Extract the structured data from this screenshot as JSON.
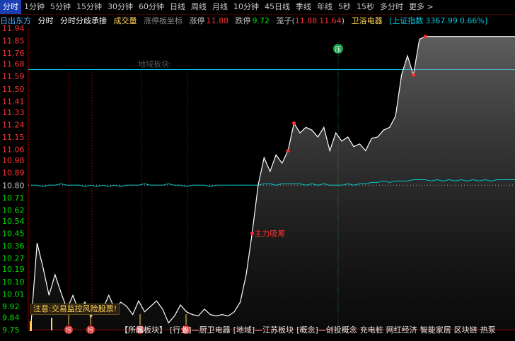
{
  "tabs": [
    "分时",
    "1分钟",
    "5分钟",
    "15分钟",
    "30分钟",
    "60分钟",
    "日线",
    "周线",
    "月线",
    "10分钟",
    "45日线",
    "季线",
    "年线",
    "5秒",
    "15秒",
    "多分时",
    "更多 >"
  ],
  "info": {
    "stock_name": "日出东方",
    "mode": "分时",
    "sub_mode": "分时分歧承接",
    "volume_label": "成交量",
    "coord_label": "涨停板坐标",
    "limit_up_label": "涨停",
    "limit_up_value": "11.88",
    "limit_down_label": "跌停",
    "limit_down_value": "9.72",
    "range_label": "笼子(",
    "range_high": "11.88",
    "range_low": "11.64",
    "range_close": ")",
    "sector": "卫浴电器",
    "index_label": "[上证指数",
    "index_value": "3367.99",
    "index_pct": "0.66%]"
  },
  "annotations": {
    "main_buy": "主力吸筹",
    "watermark": "地域板块:",
    "warning": "注意:交易监控风险股票!",
    "markers": [
      "拐",
      "拐",
      "拐",
      "拐",
      "拐"
    ],
    "top_marker": "压"
  },
  "bottom": [
    "【所属板块】",
    "[行业]—厨卫电器",
    "[地域]—江苏板块",
    "[概念]—创投概念",
    "充电桩",
    "网红经济",
    "智能家居",
    "区块链",
    "热泵"
  ],
  "colors": {
    "up": "#ff3030",
    "down": "#00e000",
    "price": "#ffffff",
    "avg": "#00c8c8",
    "grid": "#8b0000",
    "yellow": "#ffd35a",
    "cyan": "#00c8e0"
  },
  "chart_data": {
    "type": "line",
    "ylim": [
      9.75,
      11.94
    ],
    "y_ticks": [
      "11.94",
      "11.85",
      "11.76",
      "11.68",
      "11.59",
      "11.50",
      "11.41",
      "11.33",
      "11.24",
      "11.15",
      "11.06",
      "10.98",
      "10.89",
      "10.80",
      "10.71",
      "10.62",
      "10.54",
      "10.45",
      "10.36",
      "10.27",
      "10.19",
      "10.10",
      "10.01",
      "9.92",
      "9.84",
      "9.75"
    ],
    "prev_close": 10.8,
    "resistance_line": 11.64,
    "series": [
      {
        "values": [
          9.8,
          10.38,
          10.2,
          10.0,
          10.15,
          10.02,
          9.9,
          10.0,
          9.88,
          9.95,
          9.84,
          9.93,
          9.9,
          10.0,
          9.9,
          9.95,
          9.92,
          9.86,
          9.96,
          9.88,
          9.92,
          9.96,
          9.9,
          9.8,
          9.85,
          9.93,
          9.88,
          9.86,
          9.85,
          9.9,
          9.86,
          9.85,
          9.86,
          9.85,
          9.88,
          9.95,
          10.15,
          10.45,
          10.8,
          11.0,
          10.9,
          11.02,
          10.96,
          11.05,
          11.25,
          11.18,
          11.22,
          11.2,
          11.15,
          11.22,
          11.05,
          11.18,
          11.12,
          11.15,
          11.08,
          11.1,
          11.05,
          11.14,
          11.15,
          11.2,
          11.22,
          11.3,
          11.6,
          11.74,
          11.6,
          11.86,
          11.88,
          11.88,
          11.88,
          11.88,
          11.88,
          11.88,
          11.88,
          11.88,
          11.88,
          11.88,
          11.88,
          11.88,
          11.88,
          11.88,
          11.88,
          11.88
        ]
      },
      {
        "values": [
          10.8,
          10.8,
          10.79,
          10.8,
          10.8,
          10.81,
          10.8,
          10.8,
          10.8,
          10.79,
          10.8,
          10.79,
          10.8,
          10.79,
          10.8,
          10.79,
          10.8,
          10.8,
          10.8,
          10.81,
          10.8,
          10.8,
          10.8,
          10.81,
          10.8,
          10.8,
          10.79,
          10.8,
          10.8,
          10.8,
          10.79,
          10.8,
          10.8,
          10.8,
          10.8,
          10.8,
          10.8,
          10.8,
          10.8,
          10.81,
          10.81,
          10.8,
          10.81,
          10.81,
          10.81,
          10.81,
          10.8,
          10.81,
          10.8,
          10.81,
          10.8,
          10.8,
          10.8,
          10.81,
          10.8,
          10.81,
          10.81,
          10.82,
          10.82,
          10.83,
          10.82,
          10.83,
          10.83,
          10.83,
          10.84,
          10.84,
          10.84,
          10.83,
          10.84,
          10.83,
          10.84,
          10.83,
          10.84,
          10.83,
          10.84,
          10.83,
          10.84,
          10.83,
          10.84,
          10.84,
          10.84,
          10.84
        ]
      }
    ]
  }
}
